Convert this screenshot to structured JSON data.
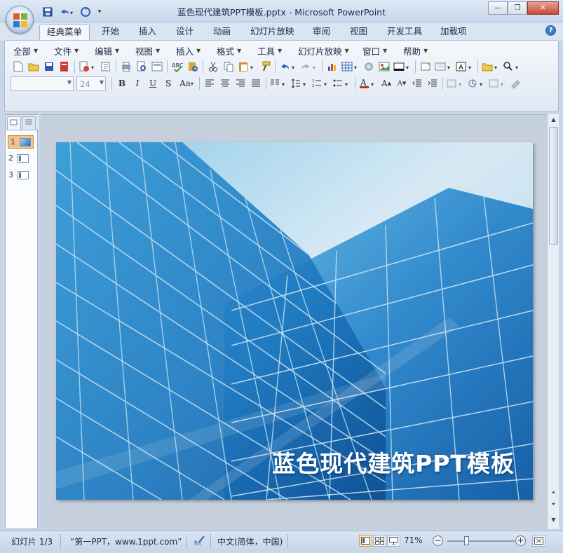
{
  "window": {
    "title": "蓝色现代建筑PPT模板.pptx - Microsoft PowerPoint",
    "controls": [
      "minimize",
      "maximize",
      "close"
    ]
  },
  "quick_access": [
    "save-icon",
    "undo-icon",
    "redo-icon",
    "customize-icon"
  ],
  "ribbon_tabs": [
    {
      "label": "经典菜单",
      "active": true
    },
    {
      "label": "开始"
    },
    {
      "label": "插入"
    },
    {
      "label": "设计"
    },
    {
      "label": "动画"
    },
    {
      "label": "幻灯片放映"
    },
    {
      "label": "审阅"
    },
    {
      "label": "视图"
    },
    {
      "label": "开发工具"
    },
    {
      "label": "加载项"
    }
  ],
  "menus": [
    "全部",
    "文件",
    "编辑",
    "视图",
    "插入",
    "格式",
    "工具",
    "幻灯片放映",
    "窗口",
    "帮助"
  ],
  "format_bar": {
    "font_name": "",
    "font_size": "24"
  },
  "slides_panel": {
    "thumbnails": [
      {
        "number": "1",
        "selected": true
      },
      {
        "number": "2"
      },
      {
        "number": "3"
      }
    ]
  },
  "slide": {
    "title": "蓝色现代建筑PPT模板"
  },
  "status": {
    "slide_info": "幻灯片 1/3",
    "theme": "“第一PPT，www.1ppt.com”",
    "language": "中文(简体，中国)",
    "zoom": "71%"
  },
  "colors": {
    "accent": "#1e56a8",
    "slide_sky": "#bfe3f7",
    "slide_glass": "#2477c2"
  }
}
